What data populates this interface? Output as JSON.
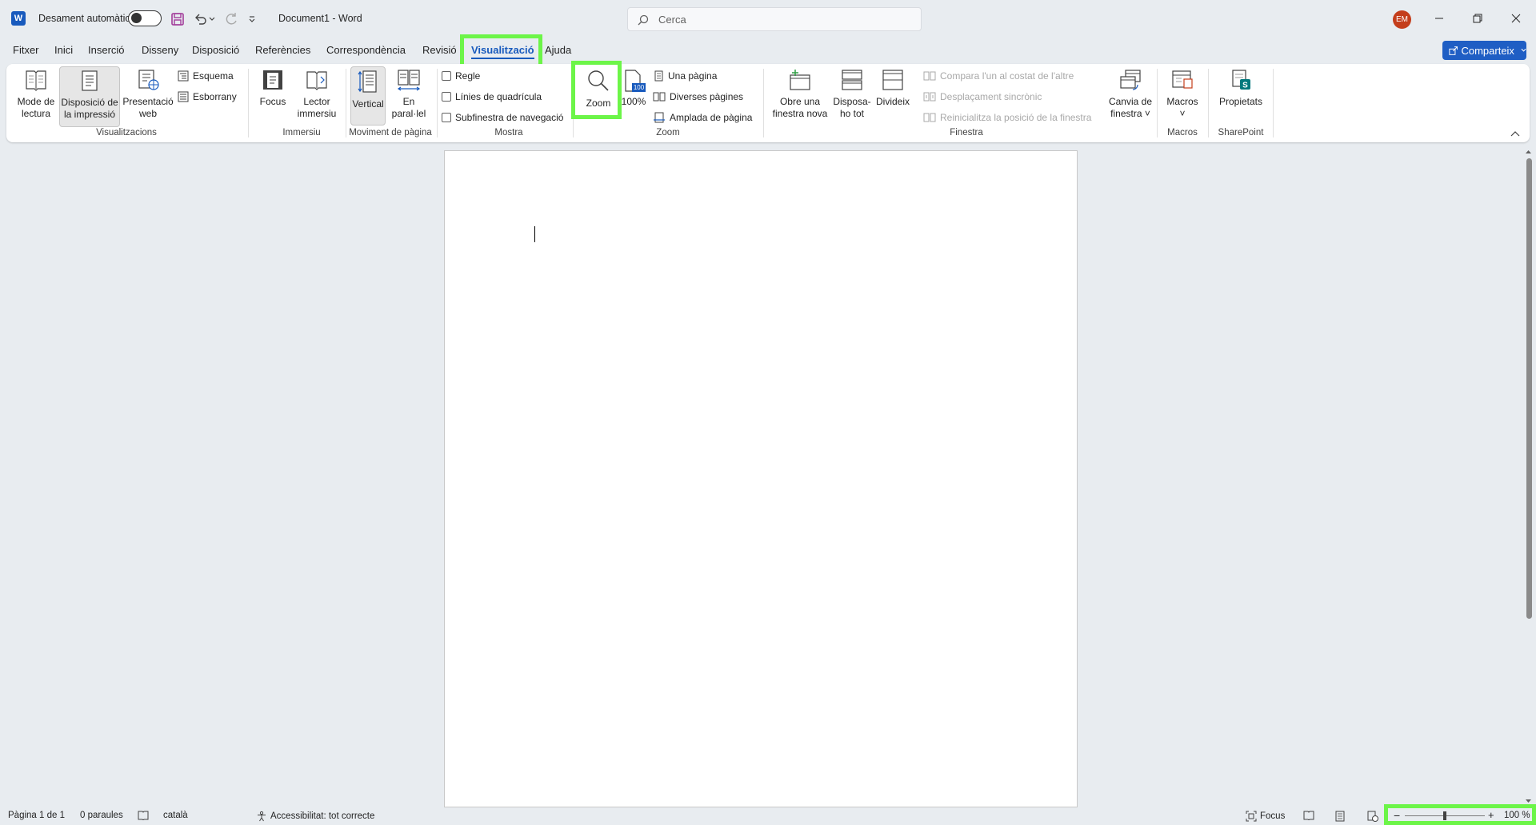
{
  "titlebar": {
    "autosave_label": "Desament automàtic",
    "doc_title": "Document1  -  Word",
    "search_placeholder": "Cerca",
    "avatar_initials": "EM"
  },
  "tabs": [
    "Fitxer",
    "Inici",
    "Inserció",
    "Disseny",
    "Disposició",
    "Referències",
    "Correspondència",
    "Revisió",
    "Visualització",
    "Ajuda"
  ],
  "active_tab": "Visualització",
  "share_label": "Comparteix",
  "ribbon": {
    "views": {
      "mode_lectura": "Mode de\nlectura",
      "disposicio_impressio": "Disposició de\nla impressió",
      "presentacio_web": "Presentació\nweb",
      "esquema": "Esquema",
      "esborrany": "Esborrany",
      "group": "Visualitzacions"
    },
    "immersive": {
      "focus": "Focus",
      "lector": "Lector\nimmersiu",
      "group": "Immersiu"
    },
    "page_movement": {
      "vertical": "Vertical",
      "parallel": "En\nparal·lel",
      "group": "Moviment de pàgina"
    },
    "show": {
      "regle": "Regle",
      "linies": "Línies de quadrícula",
      "subfinestra": "Subfinestra de navegació",
      "group": "Mostra"
    },
    "zoom": {
      "zoom": "Zoom",
      "pct100": "100%",
      "icon100": "100",
      "una_pagina": "Una pàgina",
      "diverses": "Diverses pàgines",
      "amplada": "Amplada de pàgina",
      "group": "Zoom"
    },
    "window": {
      "nova": "Obre una\nfinestra nova",
      "disposa": "Disposa-\nho tot",
      "divideix": "Divideix",
      "compara": "Compara l'un al costat de l'altre",
      "desplacament": "Desplaçament sincrònic",
      "reinicialitza": "Reinicialitza la posició de la finestra",
      "canvia": "Canvia de\nfinestra ˅",
      "group": "Finestra"
    },
    "macros": {
      "macros": "Macros\n˅",
      "group": "Macros"
    },
    "sharepoint": {
      "propietats": "Propietats",
      "group": "SharePoint"
    }
  },
  "statusbar": {
    "page": "Pàgina 1 de 1",
    "words": "0 paraules",
    "language": "català",
    "accessibility": "Accessibilitat: tot correcte",
    "focus": "Focus",
    "zoom": "100 %"
  },
  "colors": {
    "accent": "#185abd",
    "highlight": "#6cf548",
    "background": "#e8ecf0"
  }
}
